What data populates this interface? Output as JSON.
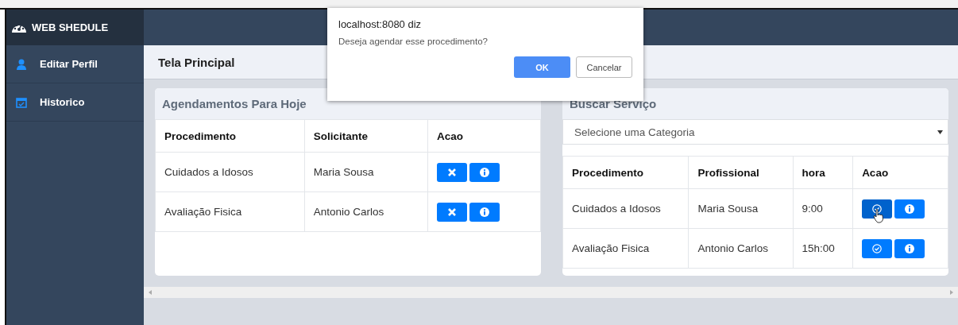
{
  "sidebar": {
    "brand": "WEB SHEDULE",
    "items": [
      {
        "label": "Editar Perfil"
      },
      {
        "label": "Historico"
      }
    ]
  },
  "page_title": "Tela Principal",
  "today_card": {
    "title": "Agendamentos Para Hoje",
    "columns": [
      "Procedimento",
      "Solicitante",
      "Acao"
    ],
    "rows": [
      {
        "cells": [
          "Cuidados a Idosos",
          "Maria Sousa"
        ],
        "hovered": false
      },
      {
        "cells": [
          "Avaliação Fisica",
          "Antonio Carlos"
        ],
        "hovered": false
      }
    ]
  },
  "service_card": {
    "title": "Buscar Serviço",
    "category_select": {
      "value": "Selecione uma Categoria"
    },
    "columns": [
      "Procedimento",
      "Profissional",
      "hora",
      "Acao"
    ],
    "rows": [
      {
        "cells": [
          "Cuidados a Idosos",
          "Maria Sousa",
          "9:00"
        ],
        "hovered": true
      },
      {
        "cells": [
          "Avaliação Fisica",
          "Antonio Carlos",
          "15h:00"
        ],
        "hovered": false
      }
    ]
  },
  "dialog": {
    "title": "localhost:8080 diz",
    "message": "Deseja agendar esse procedimento?",
    "buttons": [
      {
        "label": "OK",
        "kind": "primary"
      },
      {
        "label": "Cancelar",
        "kind": "secondary"
      }
    ]
  }
}
